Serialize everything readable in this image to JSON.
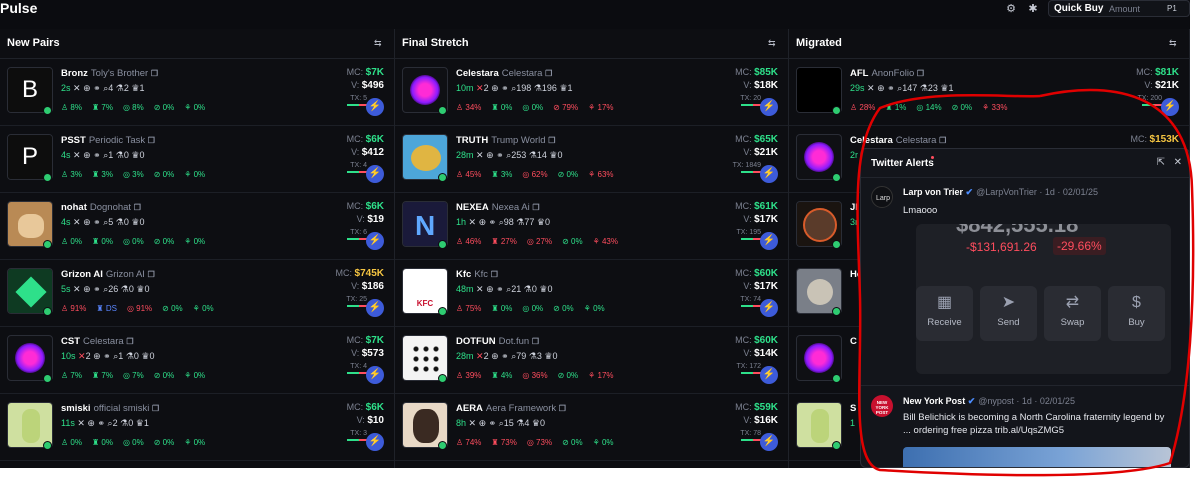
{
  "app": {
    "title": "Pulse"
  },
  "toolbar": {
    "quick_buy": "Quick Buy",
    "amount": "Amount",
    "preset": "P1"
  },
  "columns": [
    {
      "title": "New Pairs"
    },
    {
      "title": "Final Stretch"
    },
    {
      "title": "Migrated"
    }
  ],
  "new_pairs": [
    {
      "ticker": "Bronz",
      "name": "Toly's Brother",
      "age": "2s",
      "holders": "4",
      "chat": "2",
      "snipers": "1",
      "mc": "$7K",
      "v": "$496",
      "tx": "5",
      "s1": "8%",
      "s2": "7%",
      "s3": "8%",
      "s4": "0%",
      "s5": "0%"
    },
    {
      "ticker": "PSST",
      "name": "Periodic Task",
      "age": "4s",
      "holders": "1",
      "chat": "0",
      "snipers": "0",
      "mc": "$6K",
      "v": "$412",
      "tx": "4",
      "s1": "3%",
      "s2": "3%",
      "s3": "3%",
      "s4": "0%",
      "s5": "0%"
    },
    {
      "ticker": "nohat",
      "name": "Dognohat",
      "age": "4s",
      "holders": "5",
      "chat": "0",
      "snipers": "0",
      "mc": "$6K",
      "v": "$19",
      "tx": "6",
      "s1": "0%",
      "s2": "0%",
      "s3": "0%",
      "s4": "0%",
      "s5": "0%"
    },
    {
      "ticker": "Grizon AI",
      "name": "Grizon AI",
      "age": "5s",
      "holders": "26",
      "chat": "0",
      "snipers": "0",
      "mc": "$745K",
      "v": "$186",
      "tx": "25",
      "s1": "91%",
      "s2": "DS",
      "s3": "91%",
      "s4": "0%",
      "s5": "0%"
    },
    {
      "ticker": "CST",
      "name": "Celestara",
      "age": "10s",
      "x": "2",
      "holders": "1",
      "chat": "0",
      "snipers": "0",
      "mc": "$7K",
      "v": "$573",
      "tx": "4",
      "s1": "7%",
      "s2": "7%",
      "s3": "7%",
      "s4": "0%",
      "s5": "0%"
    },
    {
      "ticker": "smiski",
      "name": "official smiski",
      "age": "11s",
      "holders": "2",
      "chat": "0",
      "snipers": "1",
      "mc": "$6K",
      "v": "$10",
      "tx": "3",
      "s1": "0%",
      "s2": "0%",
      "s3": "0%",
      "s4": "0%",
      "s5": "0%"
    }
  ],
  "final_stretch": [
    {
      "ticker": "Celestara",
      "name": "Celestara",
      "age": "10m",
      "x": "2",
      "holders": "198",
      "chat": "196",
      "snipers": "1",
      "mc": "$85K",
      "v": "$18K",
      "tx": "20",
      "s1": "34%",
      "s2": "0%",
      "s3": "0%",
      "s4": "79%",
      "s5": "17%"
    },
    {
      "ticker": "TRUTH",
      "name": "Trump World",
      "age": "28m",
      "holders": "253",
      "chat": "14",
      "snipers": "0",
      "mc": "$65K",
      "v": "$21K",
      "tx": "1849",
      "s1": "45%",
      "s2": "3%",
      "s3": "62%",
      "s4": "0%",
      "s5": "63%"
    },
    {
      "ticker": "NEXEA",
      "name": "Nexea Ai",
      "age": "1h",
      "holders": "98",
      "chat": "77",
      "snipers": "0",
      "mc": "$61K",
      "v": "$17K",
      "tx": "195",
      "s1": "46%",
      "s2": "27%",
      "s3": "27%",
      "s4": "0%",
      "s5": "43%"
    },
    {
      "ticker": "Kfc",
      "name": "Kfc",
      "age": "48m",
      "holders": "21",
      "chat": "0",
      "snipers": "0",
      "mc": "$60K",
      "v": "$17K",
      "tx": "74",
      "s1": "75%",
      "s2": "0%",
      "s3": "0%",
      "s4": "0%",
      "s5": "0%"
    },
    {
      "ticker": "DOTFUN",
      "name": "Dot.fun",
      "age": "28m",
      "x": "2",
      "holders": "79",
      "chat": "3",
      "snipers": "0",
      "mc": "$60K",
      "v": "$14K",
      "tx": "172",
      "s1": "39%",
      "s2": "4%",
      "s3": "36%",
      "s4": "0%",
      "s5": "17%"
    },
    {
      "ticker": "AERA",
      "name": "Aera Framework",
      "age": "8h",
      "holders": "15",
      "chat": "4",
      "snipers": "0",
      "mc": "$59K",
      "v": "$16K",
      "tx": "78",
      "s1": "74%",
      "s2": "73%",
      "s3": "73%",
      "s4": "0%",
      "s5": "0%"
    }
  ],
  "migrated": [
    {
      "ticker": "AFL",
      "name": "AnonFolio",
      "age": "29s",
      "holders": "147",
      "chat": "23",
      "snipers": "1",
      "mc": "$81K",
      "v": "$21K",
      "tx": "200",
      "s1": "28%",
      "s2": "1%",
      "s3": "14%",
      "s4": "0%",
      "s5": "33%"
    },
    {
      "ticker": "Celestara",
      "name": "Celestara",
      "age": "2r",
      "mc": "$153K"
    },
    {
      "ticker": "JI",
      "name": "",
      "age": "3r"
    },
    {
      "ticker": "He",
      "name": "",
      "age": ""
    },
    {
      "ticker": "C",
      "name": "",
      "age": ""
    },
    {
      "ticker": "S",
      "name": "",
      "age": "1"
    }
  ],
  "twitter": {
    "title": "Twitter Alerts",
    "tweets": [
      {
        "name": "Larp von Trier",
        "handle": "@LarpVonTrier · 1d · 02/01/25",
        "avatar_label": "Larp",
        "text": "Lmaooo"
      },
      {
        "name": "New York Post",
        "handle": "@nypost · 1d · 02/01/25",
        "avatar_label": "NEW YORK POST",
        "text": "Bill Belichick is becoming a North Carolina fraternity legend by ... ordering free pizza trib.al/UqsZMG5"
      }
    ],
    "wallet": {
      "balance_ghost": "$842,555.18",
      "delta": "-$131,691.26",
      "pct": "-29.66%",
      "actions": [
        "Receive",
        "Send",
        "Swap",
        "Buy"
      ]
    }
  },
  "colors": {
    "accent_green": "#2ee08a",
    "accent_red": "#ff4d5e",
    "accent_blue": "#3d5bd9",
    "annotation_red": "#e00000"
  }
}
